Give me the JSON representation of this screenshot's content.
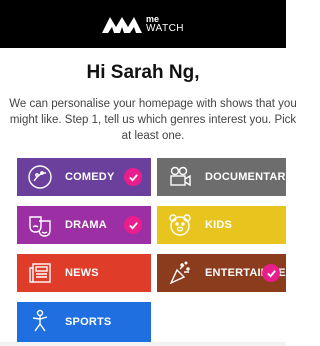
{
  "header": {
    "logo_top": "me",
    "logo_bottom": "WATCH"
  },
  "greeting": "Hi Sarah Ng,",
  "intro_lines": [
    "We can personalise your homepage with shows that you",
    "might like. Step 1, tell us which genres interest you. Pick",
    "at least one."
  ],
  "genres": [
    {
      "label": "COMEDY",
      "icon": "comedy-mask-icon",
      "color": "#6b3f9c",
      "selected": true
    },
    {
      "label": "DOCUMENTARY",
      "icon": "video-camera-icon",
      "color": "#6d6d6d",
      "selected": false
    },
    {
      "label": "DRAMA",
      "icon": "drama-masks-icon",
      "color": "#9c2fa3",
      "selected": true
    },
    {
      "label": "KIDS",
      "icon": "bear-face-icon",
      "color": "#e8c51e",
      "selected": false
    },
    {
      "label": "NEWS",
      "icon": "newspaper-icon",
      "color": "#e03c2a",
      "selected": false
    },
    {
      "label": "ENTERTAINMENT",
      "icon": "party-popper-icon",
      "color": "#8a3c1c",
      "selected": true
    },
    {
      "label": "SPORTS",
      "icon": "athlete-icon",
      "color": "#1f6fe0",
      "selected": false
    }
  ],
  "accent": "#e91e8c"
}
